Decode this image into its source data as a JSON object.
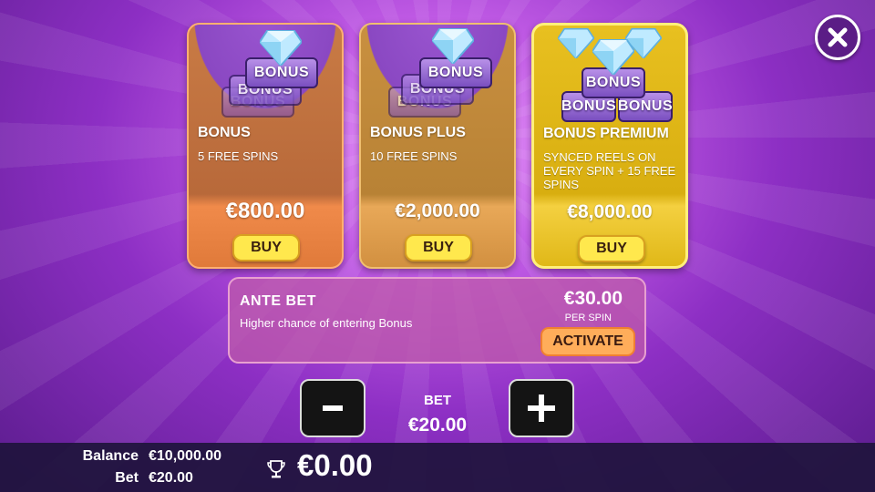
{
  "cards": [
    {
      "badge": "BONUS",
      "title": "BONUS",
      "desc": "5 FREE SPINS",
      "price": "€800.00",
      "buy": "BUY"
    },
    {
      "badge": "BONUS",
      "title": "BONUS PLUS",
      "desc": "10 FREE SPINS",
      "price": "€2,000.00",
      "buy": "BUY"
    },
    {
      "badge": "BONUS",
      "title": "BONUS PREMIUM",
      "desc": "SYNCED REELS ON EVERY SPIN + 15 FREE SPINS",
      "price": "€8,000.00",
      "buy": "BUY"
    }
  ],
  "ante": {
    "title": "ANTE BET",
    "desc": "Higher chance of entering Bonus",
    "price": "€30.00",
    "per": "PER SPIN",
    "activate": "ACTIVATE"
  },
  "bet": {
    "label": "BET",
    "value": "€20.00",
    "minus": "-",
    "plus": "+"
  },
  "footer": {
    "balance_label": "Balance",
    "balance_value": "€10,000.00",
    "bet_label": "Bet",
    "bet_value": "€20.00",
    "win": "€0.00"
  },
  "icons": {
    "close": "close-icon",
    "trophy": "trophy-icon",
    "gem": "diamond-gem-icon"
  }
}
